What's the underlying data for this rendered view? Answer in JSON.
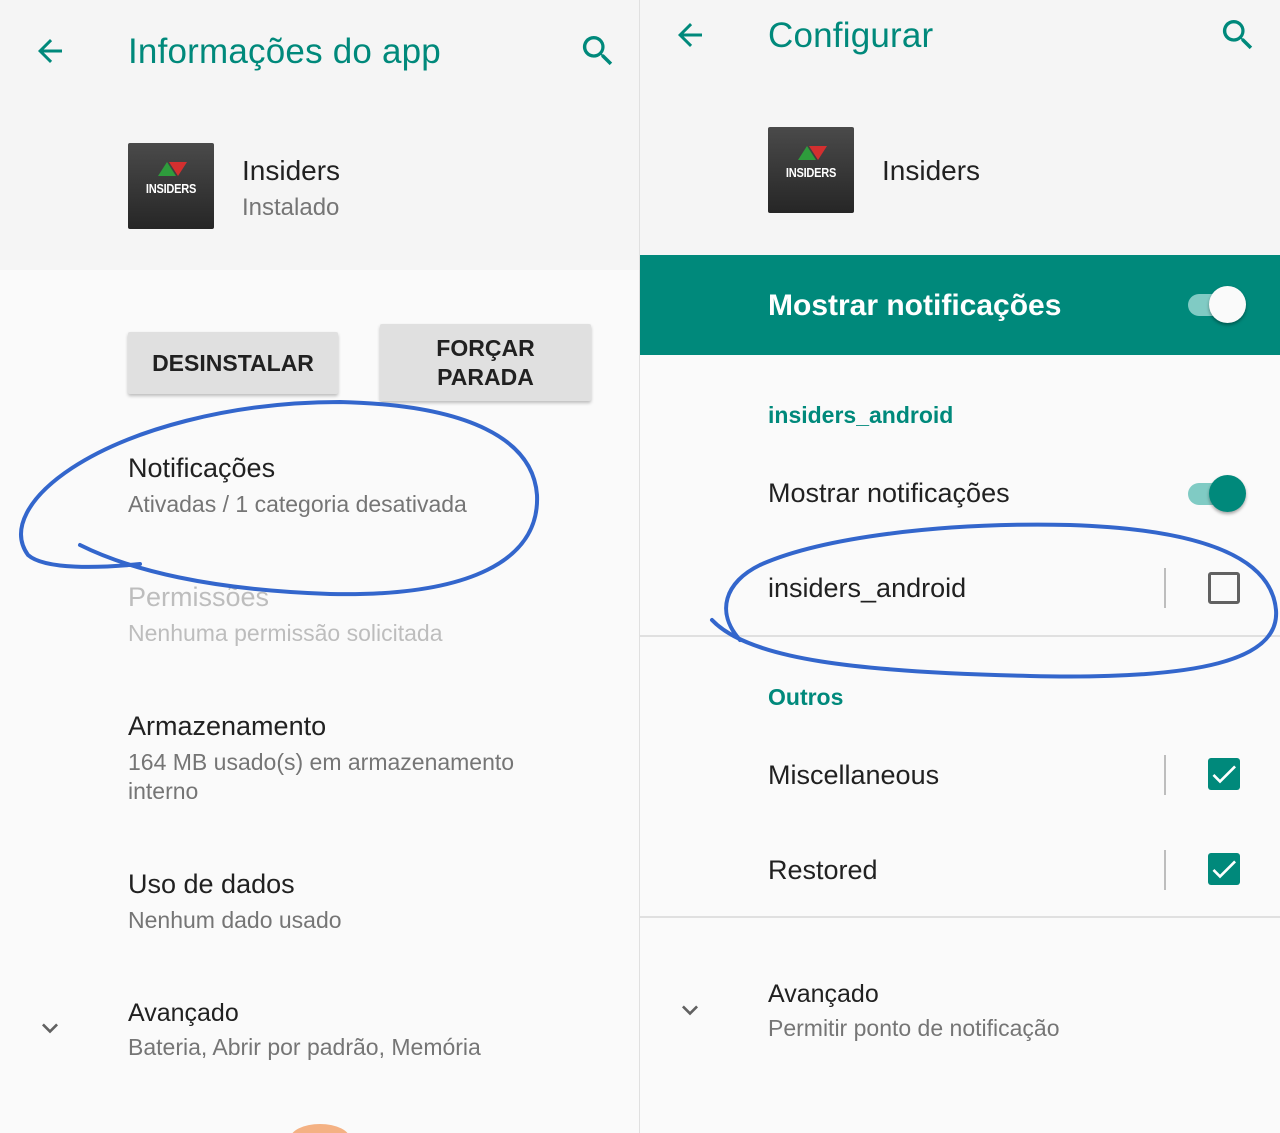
{
  "left": {
    "appbar": {
      "title": "Informações do app",
      "back_icon": "arrow-back-icon",
      "search_icon": "search-icon"
    },
    "app": {
      "name": "Insiders",
      "status": "Instalado",
      "logo_text": "INSIDERS"
    },
    "buttons": {
      "uninstall": "DESINSTALAR",
      "force_stop_line1": "FORÇAR",
      "force_stop_line2": "PARADA"
    },
    "items": {
      "notifications": {
        "title": "Notificações",
        "subtitle": "Ativadas / 1 categoria desativada"
      },
      "permissions": {
        "title": "Permissões",
        "subtitle": "Nenhuma permissão solicitada"
      },
      "storage": {
        "title": "Armazenamento",
        "subtitle_line1": "164 MB usado(s) em armazenamento",
        "subtitle_line2": "interno"
      },
      "data_usage": {
        "title": "Uso de dados",
        "subtitle": "Nenhum dado usado"
      },
      "advanced": {
        "title": "Avançado",
        "subtitle": "Bateria, Abrir por padrão, Memória"
      }
    }
  },
  "right": {
    "appbar": {
      "title": "Configurar",
      "back_icon": "arrow-back-icon",
      "search_icon": "search-icon"
    },
    "app": {
      "name": "Insiders",
      "logo_text": "INSIDERS"
    },
    "banner": {
      "title": "Mostrar notificações",
      "toggle_on": true
    },
    "section_app": {
      "header": "insiders_android",
      "show_notifications": {
        "label": "Mostrar notificações",
        "toggle_on": true
      },
      "channel": {
        "label": "insiders_android",
        "checked": false
      }
    },
    "section_others": {
      "header": "Outros",
      "channels": [
        {
          "label": "Miscellaneous",
          "checked": true
        },
        {
          "label": "Restored",
          "checked": true
        }
      ]
    },
    "advanced": {
      "title": "Avançado",
      "subtitle": "Permitir ponto de notificação"
    }
  },
  "colors": {
    "accent": "#00897b",
    "annotation": "#3366cc",
    "background": "#fafafa"
  }
}
